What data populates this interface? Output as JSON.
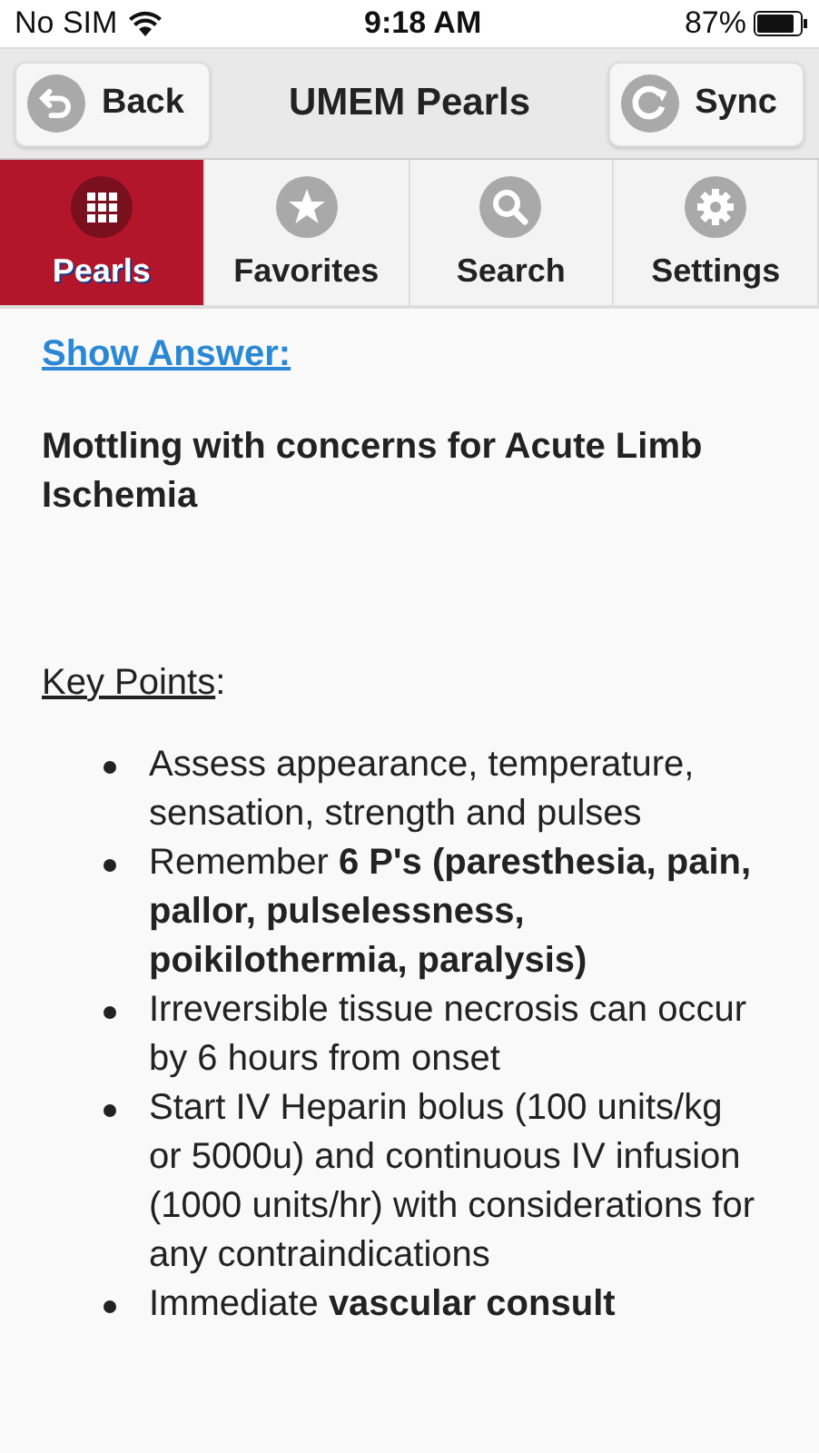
{
  "status_bar": {
    "carrier": "No SIM",
    "time": "9:18 AM",
    "battery": "87%"
  },
  "nav_bar": {
    "back": "Back",
    "title": "UMEM Pearls",
    "sync": "Sync"
  },
  "tabs": [
    {
      "label": "Pearls",
      "kind": "grid",
      "selected": true
    },
    {
      "label": "Favorites",
      "kind": "star",
      "selected": false
    },
    {
      "label": "Search",
      "kind": "search",
      "selected": false
    },
    {
      "label": "Settings",
      "kind": "gear",
      "selected": false
    }
  ],
  "content": {
    "show_answer": "Show Answer:",
    "question": "Mottling with concerns for Acute Limb Ischemia",
    "key_points_heading": {
      "text": "Key Points",
      "suffix": ":"
    },
    "key_points": [
      "Assess appearance, temperature, sensation, strength and pulses",
      "Remember **6 P's (paresthesia, pain, pallor, pulselessness, poikilothermia, paralysis)**",
      "Irreversible tissue necrosis can occur by 6 hours from onset",
      "Start IV Heparin bolus (100 units/kg or 5000u) and continuous IV infusion (1000 units/hr) with considerations for any contraindications",
      "Immediate **vascular consult**"
    ]
  }
}
